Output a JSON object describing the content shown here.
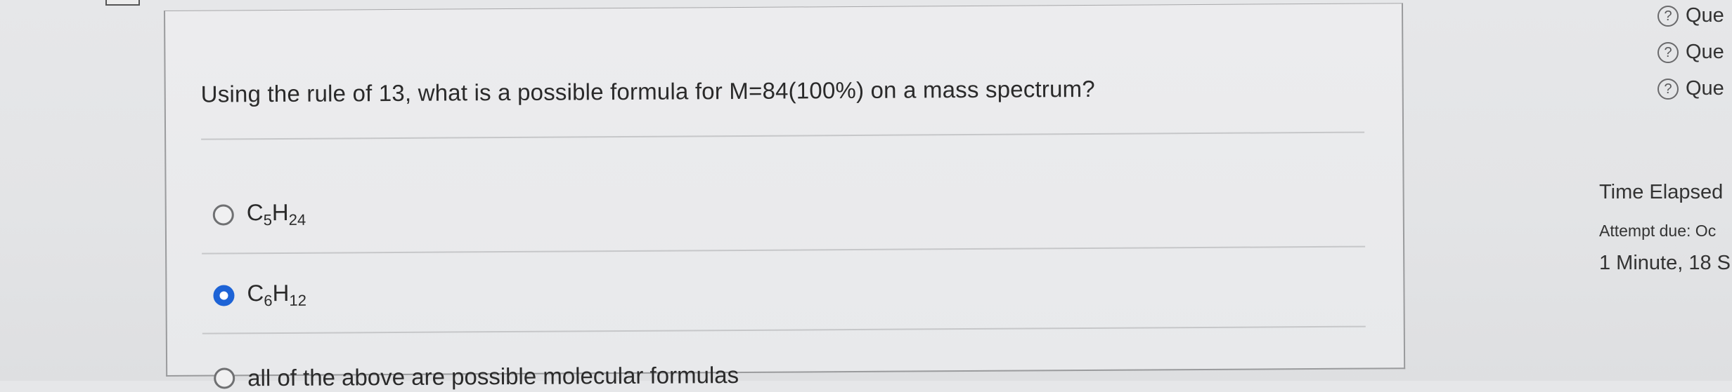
{
  "question": {
    "text": "Using the rule of 13, what is a possible formula for M=84(100%) on a mass spectrum?",
    "options": [
      {
        "c": "5",
        "h": "24",
        "selected": false
      },
      {
        "c": "6",
        "h": "12",
        "selected": true
      },
      {
        "label": "all of the above are possible molecular formulas",
        "selected": false
      }
    ]
  },
  "sidebar": {
    "question_links": [
      {
        "icon": "help-circle-icon",
        "glyph": "?",
        "label": "Que"
      },
      {
        "icon": "help-circle-icon",
        "glyph": "?",
        "label": "Que"
      },
      {
        "icon": "help-circle-icon",
        "glyph": "?",
        "label": "Que"
      }
    ],
    "time_title": "Time Elapsed",
    "attempt_due": "Attempt due: Oc",
    "elapsed": "1 Minute, 18 S"
  },
  "colors": {
    "accent": "#1d63d6",
    "background": "#e4e5e7",
    "card": "#eaebed"
  }
}
